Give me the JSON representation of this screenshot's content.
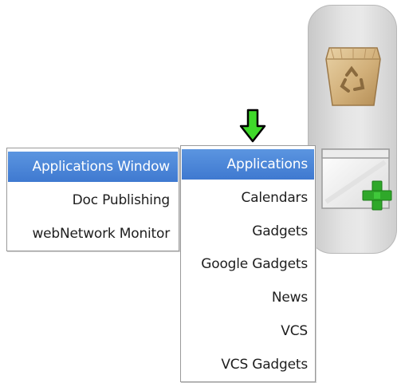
{
  "dock": {
    "icons": [
      {
        "name": "recycle-bag-icon"
      },
      {
        "name": "add-window-icon"
      }
    ]
  },
  "arrow": {
    "icon": "down-arrow-icon",
    "color": "#3fd92a"
  },
  "left_menu": {
    "items": [
      {
        "label": "Applications Window",
        "selected": true
      },
      {
        "label": "Doc Publishing",
        "selected": false
      },
      {
        "label": "webNetwork Monitor",
        "selected": false
      }
    ]
  },
  "main_menu": {
    "items": [
      {
        "label": "Applications",
        "selected": true
      },
      {
        "label": "Calendars",
        "selected": false
      },
      {
        "label": "Gadgets",
        "selected": false
      },
      {
        "label": "Google Gadgets",
        "selected": false
      },
      {
        "label": "News",
        "selected": false
      },
      {
        "label": "VCS",
        "selected": false
      },
      {
        "label": "VCS Gadgets",
        "selected": false
      }
    ]
  },
  "colors": {
    "selection": "#4a86d8",
    "arrow_green": "#3fd92a",
    "plus_green": "#2fa82a"
  }
}
